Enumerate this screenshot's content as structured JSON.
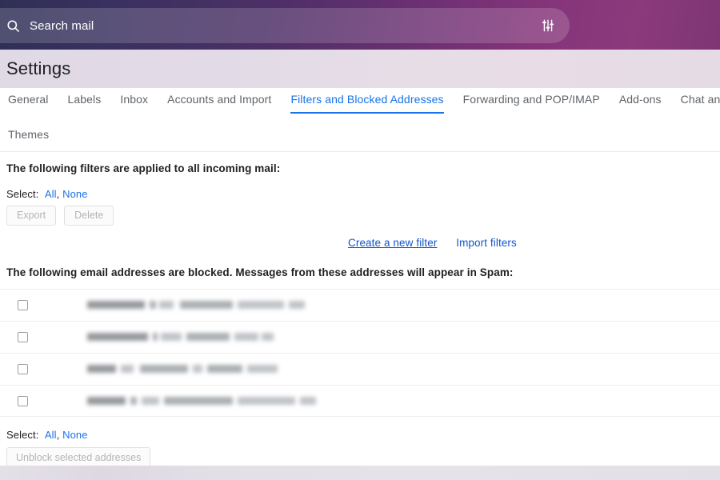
{
  "topbar": {
    "search": {
      "placeholder": "Search mail",
      "value": "",
      "icon": "search-icon"
    },
    "tune_icon": "tune-icon"
  },
  "header": {
    "title": "Settings"
  },
  "tabs": {
    "row1": [
      {
        "label": "General",
        "active": false
      },
      {
        "label": "Labels",
        "active": false
      },
      {
        "label": "Inbox",
        "active": false
      },
      {
        "label": "Accounts and Import",
        "active": false
      },
      {
        "label": "Filters and Blocked Addresses",
        "active": true
      },
      {
        "label": "Forwarding and POP/IMAP",
        "active": false
      },
      {
        "label": "Add-ons",
        "active": false
      },
      {
        "label": "Chat and Me",
        "active": false
      }
    ],
    "row2": [
      {
        "label": "Themes",
        "active": false
      }
    ]
  },
  "filters_section": {
    "heading": "The following filters are applied to all incoming mail:",
    "select_label": "Select:",
    "select_all": "All",
    "select_separator": ",",
    "select_none": "None",
    "export_button": "Export",
    "delete_button": "Delete",
    "create_filter_link": "Create a new filter",
    "import_filters_link": "Import filters"
  },
  "blocked_section": {
    "heading": "The following email addresses are blocked. Messages from these addresses will appear in Spam:",
    "rows": [
      {
        "address": "",
        "checked": false,
        "redacted": true
      },
      {
        "address": "",
        "checked": false,
        "redacted": true
      },
      {
        "address": "",
        "checked": false,
        "redacted": true
      },
      {
        "address": "",
        "checked": false,
        "redacted": true
      }
    ],
    "select_label": "Select:",
    "select_all": "All",
    "select_separator": ",",
    "select_none": "None",
    "unblock_button": "Unblock selected addresses"
  },
  "colors": {
    "accent_blue": "#1a73e8",
    "link_blue": "#1155cc",
    "header_band": "#e3dde7",
    "text_primary": "#202124",
    "text_secondary": "#5f6368"
  }
}
